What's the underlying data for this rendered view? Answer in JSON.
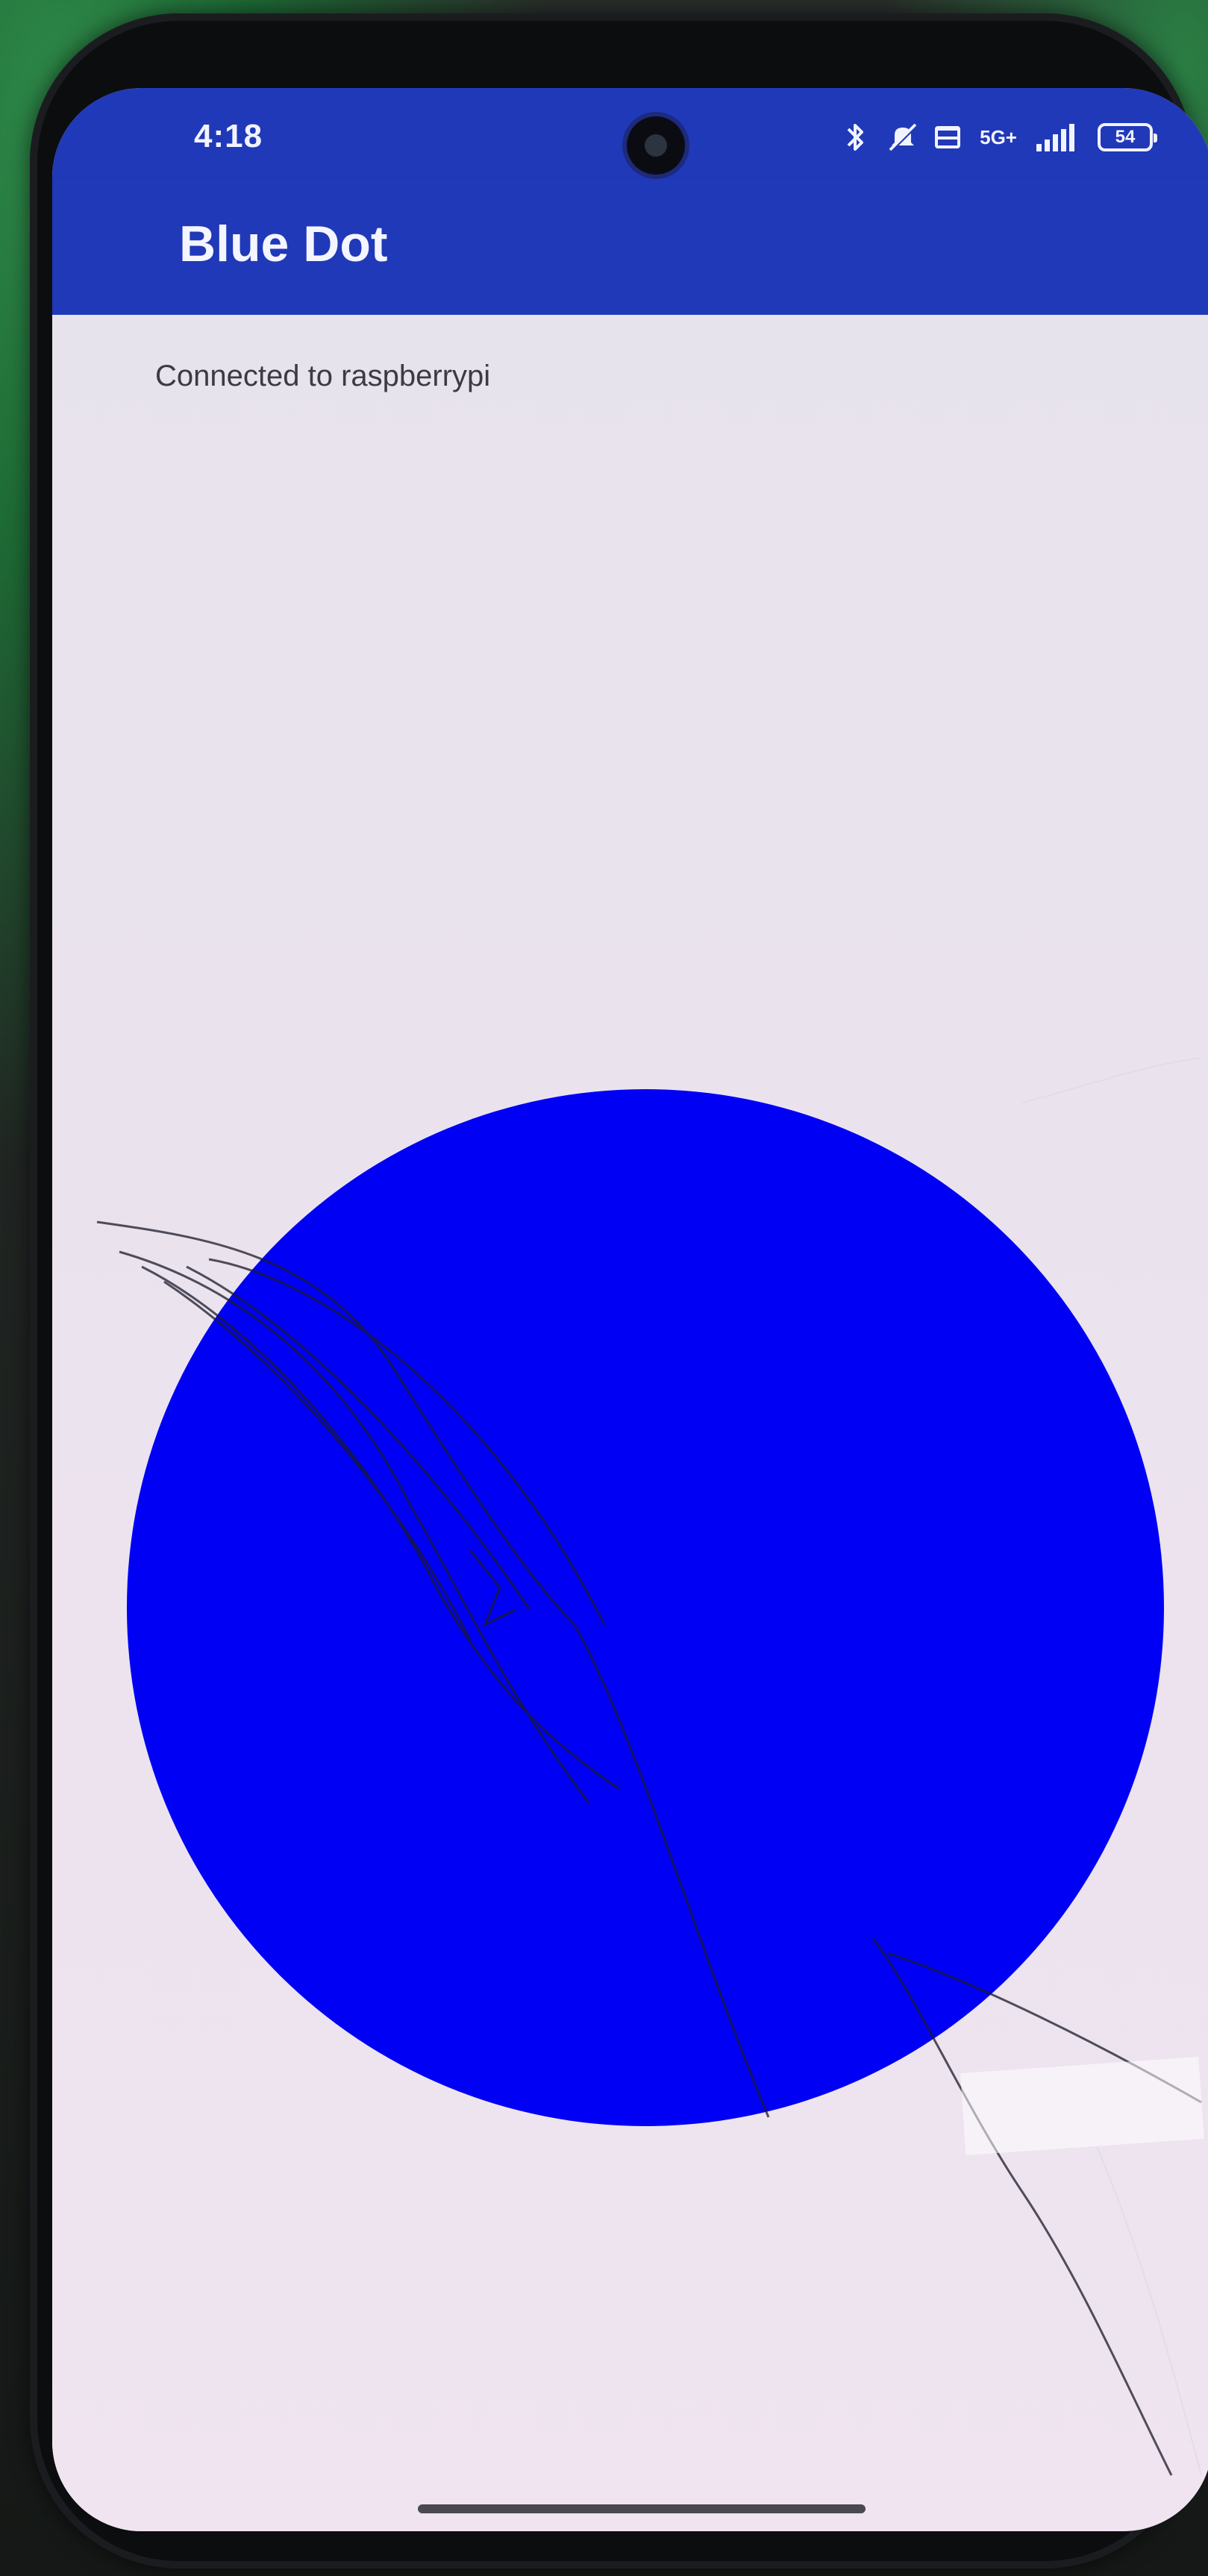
{
  "status_bar": {
    "time": "4:18",
    "network": "5G+",
    "battery": "54",
    "icons": [
      "bluetooth-icon",
      "mute-icon",
      "volte-icon",
      "signal-icon",
      "battery-icon"
    ]
  },
  "app_bar": {
    "title": "Blue Dot",
    "color": "#2039b8"
  },
  "main": {
    "connection_status": "Connected to raspberrypi",
    "dot_color": "#0000f5"
  }
}
